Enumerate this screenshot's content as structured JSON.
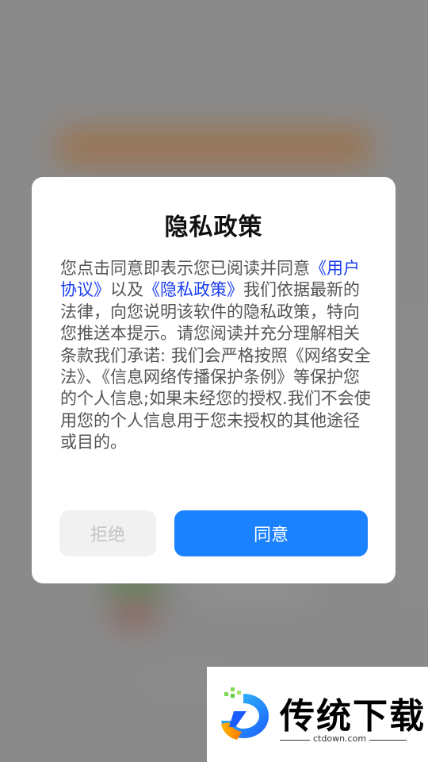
{
  "dialog": {
    "title": "隐私政策",
    "body_intro": "您点击同意即表示您已阅读并同意",
    "user_agreement_link": "《用户协议》",
    "connector": "以及",
    "privacy_policy_link": "《隐私政策》",
    "body_rest": "我们依据最新的法律，向您说明该软件的隐私政策，特向您推送本提示。请您阅读并充分理解相关条款我们承诺: 我们会严格按照《网络安全法》、《信息网络传播保护条例》等保护您的个人信息;如果未经您的授权.我们不会使用您的个人信息用于您未授权的其他途径或目的。",
    "reject_label": "拒绝",
    "agree_label": "同意"
  },
  "watermark": {
    "brand": "传统下载",
    "url": "ctdown.com"
  },
  "colors": {
    "accent": "#1a82ff",
    "link": "#1a3df0"
  }
}
